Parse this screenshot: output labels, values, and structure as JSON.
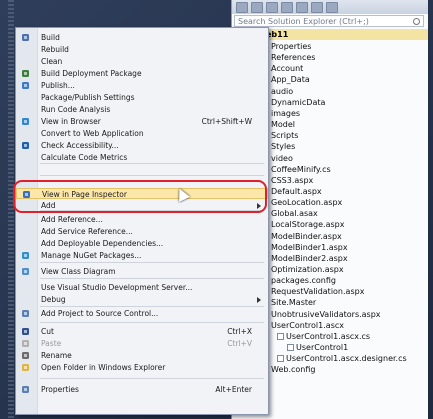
{
  "solution_explorer": {
    "search_placeholder": "Search Solution Explorer (Ctrl+;)",
    "root_label": "eb11",
    "items": [
      {
        "label": "Properties",
        "kind": "folder",
        "level": 1
      },
      {
        "label": "References",
        "kind": "folder",
        "level": 1
      },
      {
        "label": "Account",
        "kind": "folder",
        "level": 1
      },
      {
        "label": "App_Data",
        "kind": "folder",
        "level": 1
      },
      {
        "label": "audio",
        "kind": "folder",
        "level": 1
      },
      {
        "label": "DynamicData",
        "kind": "folder",
        "level": 1
      },
      {
        "label": "images",
        "kind": "folder",
        "level": 1
      },
      {
        "label": "Model",
        "kind": "folder",
        "level": 1
      },
      {
        "label": "Scripts",
        "kind": "folder",
        "level": 1
      },
      {
        "label": "Styles",
        "kind": "folder",
        "level": 1
      },
      {
        "label": "video",
        "kind": "folder",
        "level": 1
      },
      {
        "label": "CoffeeMinify.cs",
        "kind": "file",
        "level": 1
      },
      {
        "label": "CSS3.aspx",
        "kind": "file",
        "level": 1
      },
      {
        "label": "Default.aspx",
        "kind": "file",
        "level": 1
      },
      {
        "label": "GeoLocation.aspx",
        "kind": "file",
        "level": 1
      },
      {
        "label": "Global.asax",
        "kind": "file",
        "level": 1
      },
      {
        "label": "LocalStorage.aspx",
        "kind": "file",
        "level": 1
      },
      {
        "label": "ModelBinder.aspx",
        "kind": "file",
        "level": 1
      },
      {
        "label": "ModelBinder1.aspx",
        "kind": "file",
        "level": 1
      },
      {
        "label": "ModelBinder2.aspx",
        "kind": "file",
        "level": 1
      },
      {
        "label": "Optimization.aspx",
        "kind": "file",
        "level": 1
      },
      {
        "label": "packages.config",
        "kind": "file",
        "level": 1
      },
      {
        "label": "RequestValidation.aspx",
        "kind": "file",
        "level": 1
      },
      {
        "label": "Site.Master",
        "kind": "file",
        "level": 1
      },
      {
        "label": "UnobtrusiveValidators.aspx",
        "kind": "file",
        "level": 1
      },
      {
        "label": "UserControl1.ascx",
        "kind": "file",
        "level": 1
      },
      {
        "label": "UserControl1.ascx.cs",
        "kind": "file",
        "level": 2
      },
      {
        "label": "UserControl1",
        "kind": "file",
        "level": 3
      },
      {
        "label": "UserControl1.ascx.designer.cs",
        "kind": "file",
        "level": 2
      },
      {
        "label": "Web.config",
        "kind": "file",
        "level": 1
      }
    ]
  },
  "context_menu": {
    "items": [
      {
        "label": "Build",
        "icon": "build-icon"
      },
      {
        "label": "Rebuild",
        "icon": ""
      },
      {
        "label": "Clean",
        "icon": ""
      },
      {
        "label": "Build Deployment Package",
        "icon": "package-icon"
      },
      {
        "label": "Publish...",
        "icon": "publish-icon"
      },
      {
        "label": "Package/Publish Settings",
        "icon": ""
      },
      {
        "label": "Run Code Analysis",
        "icon": ""
      },
      {
        "label": "View in Browser",
        "shortcut": "Ctrl+Shift+W",
        "icon": "browser-icon"
      },
      {
        "label": "Convert to Web Application",
        "icon": ""
      },
      {
        "label": "Check Accessibility...",
        "icon": "accessibility-icon"
      },
      {
        "label": "Calculate Code Metrics",
        "icon": ""
      },
      {
        "label": "View in Page Inspector",
        "icon": "page-inspector-icon",
        "highlighted": true
      },
      {
        "label": "Add",
        "submenu": true,
        "icon": ""
      },
      {
        "label": "Add Reference...",
        "icon": ""
      },
      {
        "label": "Add Service Reference...",
        "icon": ""
      },
      {
        "label": "Add Deployable Dependencies...",
        "icon": ""
      },
      {
        "label": "Manage NuGet Packages...",
        "icon": "nuget-icon"
      },
      {
        "label": "View Class Diagram",
        "icon": "class-diagram-icon"
      },
      {
        "label": "Use Visual Studio Development Server...",
        "icon": ""
      },
      {
        "label": "Debug",
        "submenu": true,
        "icon": ""
      },
      {
        "label": "Add Project to Source Control...",
        "icon": "source-control-icon"
      },
      {
        "label": "Cut",
        "shortcut": "Ctrl+X",
        "icon": "cut-icon"
      },
      {
        "label": "Paste",
        "shortcut": "Ctrl+V",
        "icon": "paste-icon",
        "disabled": true
      },
      {
        "label": "Rename",
        "icon": "rename-icon"
      },
      {
        "label": "Open Folder in Windows Explorer",
        "icon": "folder-icon"
      },
      {
        "label": "Properties",
        "shortcut": "Alt+Enter",
        "icon": "properties-icon"
      }
    ]
  },
  "colors": {
    "highlight_bg": "#fbe7a9",
    "annotation_red": "#e0202a",
    "root_bg": "#f4e4a3"
  }
}
